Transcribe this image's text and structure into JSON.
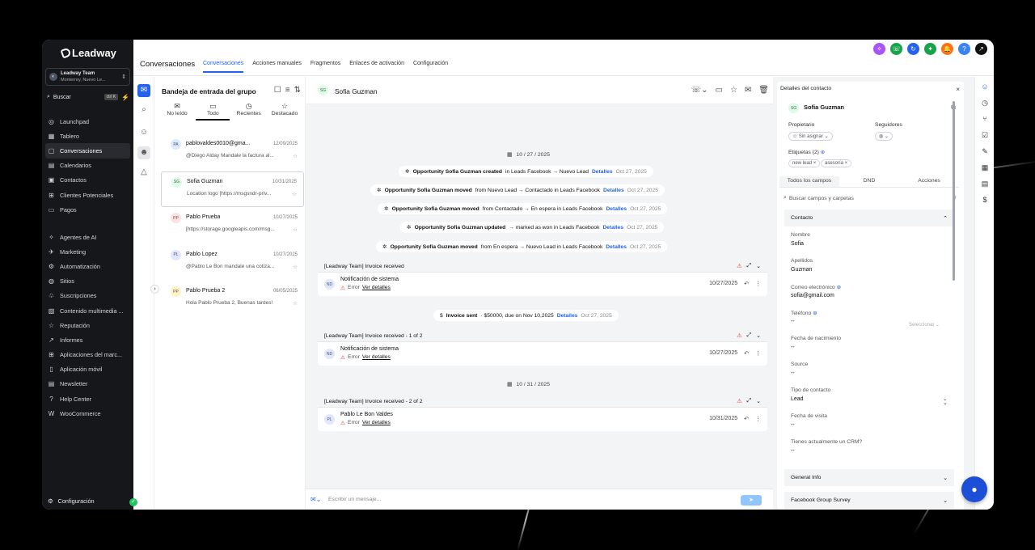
{
  "sidebar": {
    "brand": "Leadway",
    "account": {
      "name": "Leadway Team",
      "sub": "Monterrey, Nuevo Le..."
    },
    "search": {
      "label": "Buscar",
      "kbd": "ctrl K"
    },
    "nav1": [
      {
        "icon": "◎",
        "label": "Launchpad"
      },
      {
        "icon": "▦",
        "label": "Tablero"
      },
      {
        "icon": "▢",
        "label": "Conversaciones",
        "active": true
      },
      {
        "icon": "▤",
        "label": "Calendarios"
      },
      {
        "icon": "▣",
        "label": "Contactos"
      },
      {
        "icon": "⊞",
        "label": "Clientes Potenciales"
      },
      {
        "icon": "▭",
        "label": "Pagos"
      }
    ],
    "nav2": [
      {
        "icon": "✧",
        "label": "Agentes de AI"
      },
      {
        "icon": "✈",
        "label": "Marketing"
      },
      {
        "icon": "⚙",
        "label": "Automatización"
      },
      {
        "icon": "◍",
        "label": "Sitios"
      },
      {
        "icon": "♧",
        "label": "Suscripciones"
      },
      {
        "icon": "▧",
        "label": "Contenido multimedia ..."
      },
      {
        "icon": "☆",
        "label": "Reputación"
      },
      {
        "icon": "↗",
        "label": "Informes"
      },
      {
        "icon": "⊞",
        "label": "Aplicaciones del marc..."
      },
      {
        "icon": "▯",
        "label": "Aplicación móvil"
      },
      {
        "icon": "▤",
        "label": "Newsletter"
      },
      {
        "icon": "?",
        "label": "Help Center"
      },
      {
        "icon": "W",
        "label": "WooCommerce"
      }
    ],
    "settings": "Configuración"
  },
  "topbar": {
    "title": "Conversaciones",
    "tabs": [
      "Conversaciones",
      "Acciones manuales",
      "Fragmentos",
      "Enlaces de activación",
      "Configuración"
    ],
    "icon_colors": [
      "#a855f7",
      "#16a34a",
      "#2563eb",
      "#16a34a",
      "#f97316",
      "#3b82f6",
      "#111111"
    ]
  },
  "list": {
    "title": "Bandeja de entrada del grupo",
    "filters": [
      {
        "icon": "✉",
        "label": "No leído"
      },
      {
        "icon": "▭",
        "label": "Todo",
        "active": true
      },
      {
        "icon": "◷",
        "label": "Recientes"
      },
      {
        "icon": "☆",
        "label": "Destacado"
      }
    ],
    "items": [
      {
        "initials": "PA",
        "color": "#dbeafe",
        "name": "pablovaldes0010@gma...",
        "date": "12/09/2025",
        "preview": "@Diego Alday Mandale la factura al..."
      },
      {
        "initials": "SG",
        "color": "#dcfce7",
        "name": "Sofia Guzman",
        "date": "10/31/2025",
        "preview": "Location logo [https://msgsndr-priv..."
      },
      {
        "initials": "PP",
        "color": "#fee2e2",
        "name": "Pablo Prueba",
        "date": "10/27/2025",
        "preview": "[https://storage.googleapis.com/msg..."
      },
      {
        "initials": "PL",
        "color": "#e0e7ff",
        "name": "Pablo Lopez",
        "date": "10/27/2025",
        "preview": "@Pablo Le Bon mandale una cotiza..."
      },
      {
        "initials": "PP",
        "color": "#fef3c7",
        "name": "Pablo Prueba 2",
        "date": "06/05/2025",
        "preview": "Hola Pablo Prueba 2, Buenas tardes!"
      }
    ]
  },
  "thread": {
    "contact": "Sofia Guzman",
    "contact_initials": "SG",
    "date1": "10 / 27 / 2025",
    "date2": "10 / 31 / 2025",
    "events": [
      {
        "b": "Opportunity Sofia Guzman created",
        "t": "in Leads Facebook → Nuevo Lead",
        "link": "Detalles",
        "d": "Oct 27, 2025"
      },
      {
        "b": "Opportunity Sofia Guzman moved",
        "t": "from Nuevo Lead → Contactado in Leads Facebook",
        "link": "Detalles",
        "d": "Oct 27, 2025"
      },
      {
        "b": "Opportunity Sofia Guzman moved",
        "t": "from Contactado → En espera in Leads Facebook",
        "link": "Detalles",
        "d": "Oct 27, 2025"
      },
      {
        "b": "Opportunity Sofia Guzman updated",
        "t": "→ marked as won in Leads Facebook",
        "link": "Detalles",
        "d": "Oct 27, 2025"
      },
      {
        "b": "Opportunity Sofia Guzman moved",
        "t": "from En espera → Nuevo Lead in Leads Facebook",
        "link": "Detalles",
        "d": "Oct 27, 2025"
      }
    ],
    "invoice_sent": {
      "b": "Invoice sent",
      "t": "· $50000, due on Nov 10,2025",
      "link": "Detalles",
      "d": "Oct 27, 2025"
    },
    "cards": [
      {
        "head": "[Leadway Team] Invoice received",
        "initials": "ND",
        "title": "Notificación de sistema",
        "error": "Error",
        "link": "Ver detalles",
        "date": "10/27/2025"
      },
      {
        "head": "[Leadway Team] Invoice received - 1 of 2",
        "initials": "ND",
        "title": "Notificación de sistema",
        "error": "Error",
        "link": "Ver detalles",
        "date": "10/27/2025"
      },
      {
        "head": "[Leadway Team] Invoice received - 2 of 2",
        "initials": "PL",
        "title": "Pablo Le Bon Valdes",
        "error": "Error",
        "link": "Ver detalles",
        "date": "10/31/2025"
      }
    ],
    "composer_placeholder": "Escribir un mensaje..."
  },
  "details": {
    "title": "Detalles del contacto",
    "name": "Sofia Guzman",
    "initials": "SG",
    "owner_label": "Propietario",
    "owner_value": "Sin asignar",
    "followers_label": "Seguidores",
    "tags_label": "Etiquetas (2)",
    "tags": [
      "new lead",
      "asesoría"
    ],
    "tabs": [
      "Todos los campos",
      "DND",
      "Acciones"
    ],
    "search": "Buscar campos y carpetas",
    "section_contact": "Contacto",
    "fields": [
      {
        "label": "Nombre",
        "value": "Sofia"
      },
      {
        "label": "Apellidos",
        "value": "Guzman"
      },
      {
        "label": "Correo electrónico",
        "value": "sofia@gmail.com"
      },
      {
        "label": "Teléfono",
        "value": "--"
      },
      {
        "label": "Fecha de nacimiento",
        "value": "--"
      },
      {
        "label": "Source",
        "value": "--"
      },
      {
        "label": "Tipo de contacto",
        "value": "Lead"
      },
      {
        "label": "Fecha de visita",
        "value": "--"
      },
      {
        "label": "Tienes actualmente un CRM?",
        "value": "--"
      }
    ],
    "phone_select": "Seleccionar",
    "section_general": "General Info",
    "section_survey": "Facebook Group Survey"
  }
}
